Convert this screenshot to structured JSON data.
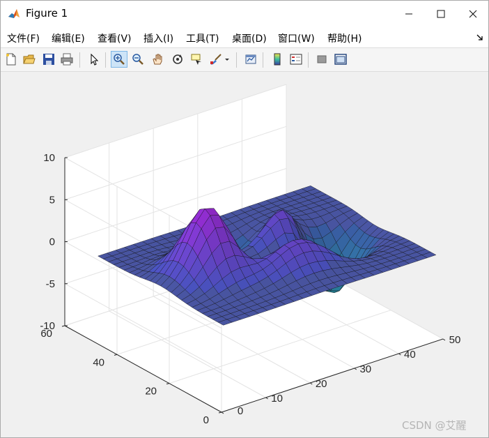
{
  "window": {
    "title": "Figure 1",
    "minimize_symbol": "—",
    "maximize_symbol": "☐",
    "close_symbol": "✕",
    "icon": "matlab-logo-icon"
  },
  "menubar": {
    "items": [
      {
        "label": "文件(F)"
      },
      {
        "label": "编辑(E)"
      },
      {
        "label": "查看(V)"
      },
      {
        "label": "插入(I)"
      },
      {
        "label": "工具(T)"
      },
      {
        "label": "桌面(D)"
      },
      {
        "label": "窗口(W)"
      },
      {
        "label": "帮助(H)"
      }
    ],
    "dock_icon": "dock-arrow-icon"
  },
  "toolbar": {
    "icons": [
      "new-figure-icon",
      "open-file-icon",
      "save-icon",
      "print-icon",
      "edit-plot-arrow-icon",
      "zoom-in-icon",
      "zoom-out-icon",
      "pan-hand-icon",
      "rotate-3d-icon",
      "data-cursor-icon",
      "brush-icon",
      "brush-dropdown-icon",
      "link-plot-icon",
      "colorbar-icon",
      "legend-icon",
      "hide-plot-tools-icon",
      "show-plot-tools-icon"
    ],
    "active": "zoom-in-icon"
  },
  "chart_data": {
    "type": "surface",
    "title": "",
    "xlabel": "",
    "ylabel": "",
    "zlabel": "",
    "xlim": [
      0,
      50
    ],
    "ylim": [
      0,
      60
    ],
    "zlim": [
      -10,
      10
    ],
    "x_ticks": [
      "0",
      "10",
      "20",
      "30",
      "40",
      "50"
    ],
    "y_ticks": [
      "0",
      "20",
      "40",
      "60"
    ],
    "z_ticks": [
      "10",
      "5",
      "0",
      "-5",
      "-10"
    ],
    "grid": true,
    "colormap": "cool-purple",
    "surface_peaks_z": [
      8,
      3.5,
      3
    ],
    "surface_trough_z": -6.5
  },
  "watermark": "CSDN @艾醒",
  "colors": {
    "surface_low": "#2a6f86",
    "surface_mid": "#4b55c4",
    "surface_high": "#9b28c9",
    "flat": "#4b5aa6",
    "background": "#f0f0f0"
  }
}
